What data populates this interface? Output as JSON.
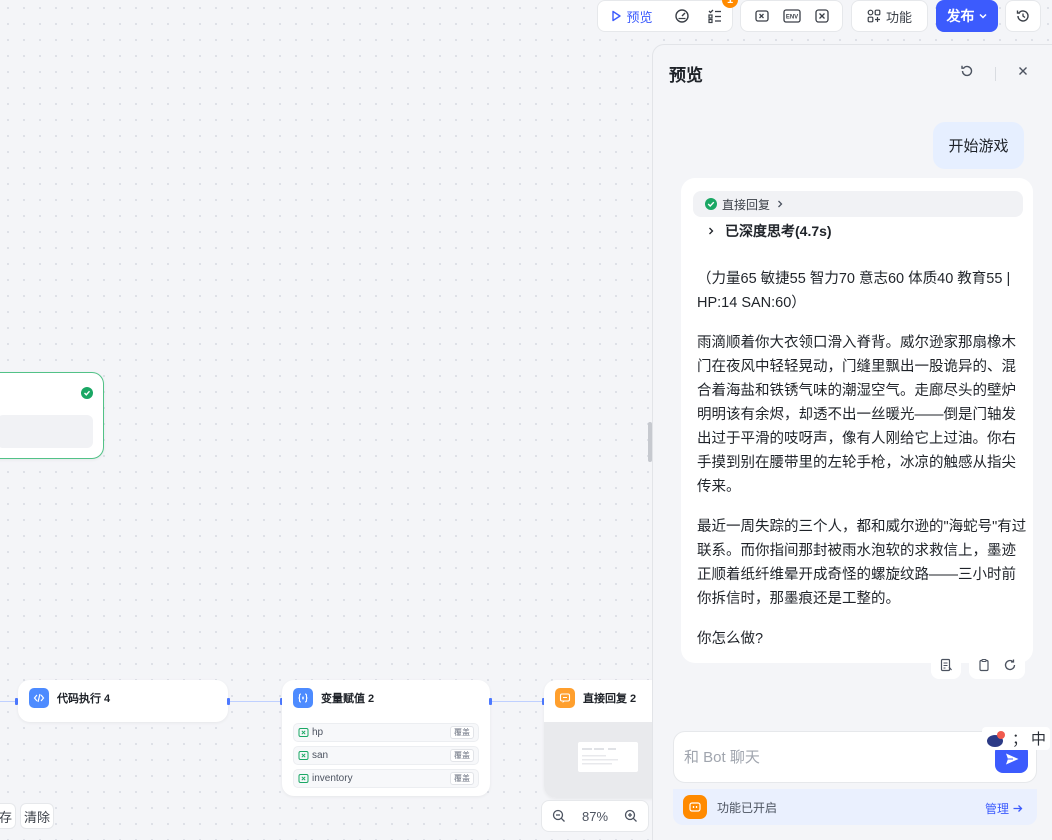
{
  "toolbar": {
    "preview_label": "预览",
    "badge_count": "1",
    "feature_label": "功能",
    "publish_label": "发布"
  },
  "canvas": {
    "nodes": {
      "code": {
        "title": "代码执行 4"
      },
      "var": {
        "title": "变量赋值 2",
        "rows": [
          {
            "name": "hp",
            "tag": "覆盖"
          },
          {
            "name": "san",
            "tag": "覆盖"
          },
          {
            "name": "inventory",
            "tag": "覆盖"
          }
        ]
      },
      "reply": {
        "title": "直接回复 2"
      }
    },
    "zoom": "87%",
    "left_button_partial": "存",
    "clear_label": "清除"
  },
  "preview": {
    "title": "预览",
    "user_message": "开始游戏",
    "chip_label": "直接回复",
    "thinking_label": "已深度思考(4.7s)",
    "paragraphs": [
      "（力量65 敏捷55 智力70 意志60 体质40 教育55 | HP:14 SAN:60）",
      "雨滴顺着你大衣领口滑入脊背。威尔逊家那扇橡木门在夜风中轻轻晃动，门缝里飘出一股诡异的、混合着海盐和铁锈气味的潮湿空气。走廊尽头的壁炉明明该有余烬，却透不出一丝暖光——倒是门轴发出过于平滑的吱呀声，像有人刚给它上过油。你右手摸到别在腰带里的左轮手枪，冰凉的触感从指尖传来。",
      "最近一周失踪的三个人，都和威尔逊的\"海蛇号\"有过联系。而你指间那封被雨水泡软的求救信上，墨迹正顺着纸纤维晕开成奇怪的螺旋纹路——三小时前你拆信时，那墨痕还是工整的。",
      "你怎么做?"
    ],
    "input_placeholder": "和 Bot 聊天",
    "feature_status": "功能已开启",
    "manage_label": "管理"
  },
  "ime": {
    "label": "中"
  },
  "colors": {
    "accent": "#3c5bfd",
    "success": "#1aa764",
    "warning": "#ff8a00"
  }
}
